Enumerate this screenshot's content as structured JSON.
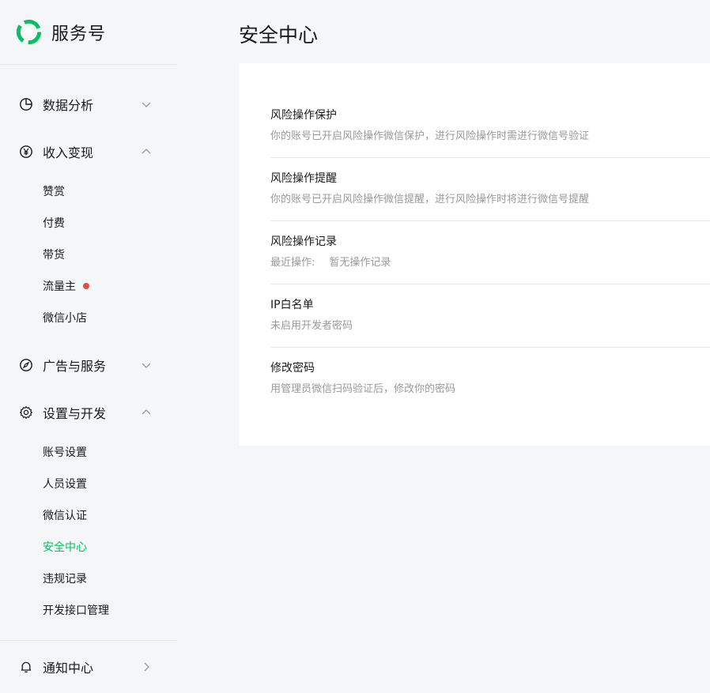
{
  "brand": {
    "name": "服务号",
    "accent": "#07c160"
  },
  "sidebar": {
    "groups": [
      {
        "label": "数据分析",
        "icon": "pie-chart-icon",
        "expanded": false
      },
      {
        "label": "收入变现",
        "icon": "yen-icon",
        "expanded": true,
        "items": [
          "赞赏",
          "付费",
          "带货",
          "流量主",
          "微信小店"
        ]
      },
      {
        "label": "广告与服务",
        "icon": "compass-icon",
        "expanded": false
      },
      {
        "label": "设置与开发",
        "icon": "gear-icon",
        "expanded": true,
        "items": [
          "账号设置",
          "人员设置",
          "微信认证",
          "安全中心",
          "违规记录",
          "开发接口管理"
        ]
      },
      {
        "label": "通知中心",
        "icon": "bell-icon",
        "expanded": false
      }
    ],
    "active_item": "安全中心"
  },
  "page": {
    "title": "安全中心",
    "rows": [
      {
        "title": "风险操作保护",
        "desc": "你的账号已开启风险操作微信保护，进行风险操作时需进行微信号验证"
      },
      {
        "title": "风险操作提醒",
        "desc": "你的账号已开启风险操作微信提醒，进行风险操作时将进行微信号提醒"
      },
      {
        "title": "风险操作记录",
        "desc_label": "最近操作:",
        "desc_value": "暂无操作记录"
      },
      {
        "title": "IP白名单",
        "desc": "未启用开发者密码"
      },
      {
        "title": "修改密码",
        "desc": "用管理员微信扫码验证后，修改你的密码"
      }
    ]
  }
}
